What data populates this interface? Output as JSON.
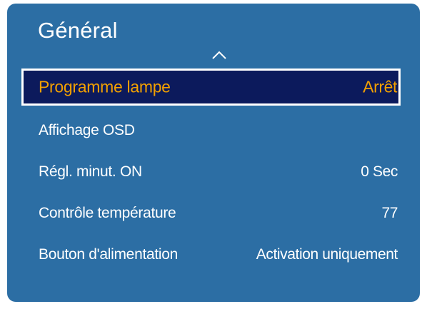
{
  "menu": {
    "title": "Général",
    "items": [
      {
        "label": "Programme lampe",
        "value": "Arrêt"
      },
      {
        "label": "Affichage OSD",
        "value": ""
      },
      {
        "label": "Régl. minut. ON",
        "value": "0 Sec"
      },
      {
        "label": "Contrôle température",
        "value": "77"
      },
      {
        "label": "Bouton d'alimentation",
        "value": "Activation uniquement"
      }
    ],
    "selected_index": 0
  },
  "icons": {
    "scroll_up": "chevron-up-icon"
  },
  "colors": {
    "panel_background": "#2c6ea4",
    "selected_background": "#0c1a5c",
    "selected_text": "#f2a000",
    "text": "#ffffff"
  }
}
